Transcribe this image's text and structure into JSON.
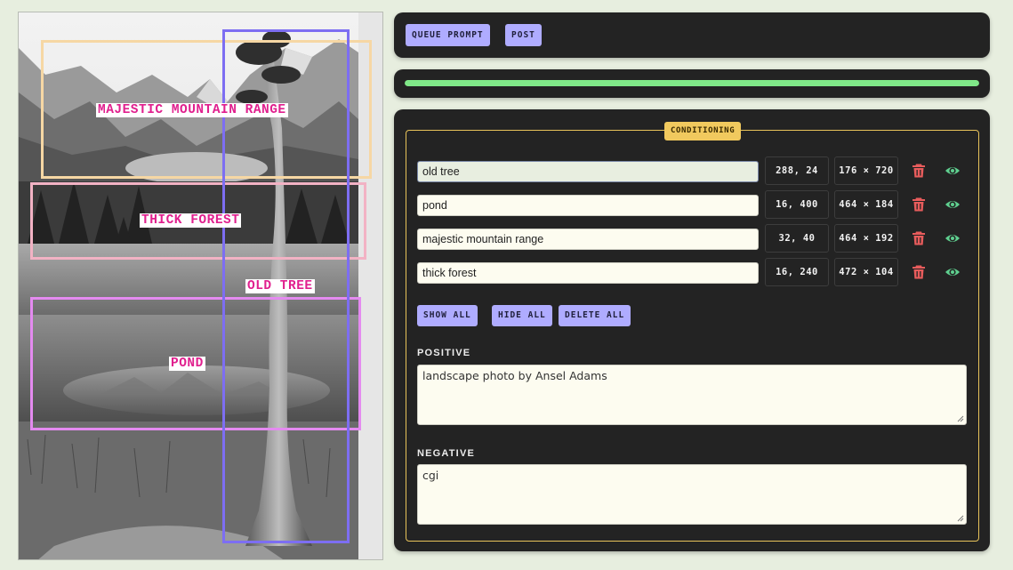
{
  "image": {
    "regions": [
      {
        "key": "mountain",
        "label": "MAJESTIC MOUNTAIN RANGE",
        "color": "#f6d7a4"
      },
      {
        "key": "forest",
        "label": "THICK FOREST",
        "color": "#f2b2c4"
      },
      {
        "key": "tree",
        "label": "OLD TREE",
        "color": "#7d6ef2"
      },
      {
        "key": "pond",
        "label": "POND",
        "color": "#e48af0"
      }
    ]
  },
  "toolbar": {
    "queue_prompt_label": "QUEUE PROMPT",
    "post_label": "POST"
  },
  "progress": {
    "percent": 100,
    "color": "#80e888"
  },
  "conditioning": {
    "legend": "CONDITIONING",
    "rows": [
      {
        "prompt": "old tree",
        "position": "288, 24",
        "size": "176 × 720"
      },
      {
        "prompt": "pond",
        "position": "16, 400",
        "size": "464 × 184"
      },
      {
        "prompt": "majestic mountain range",
        "position": "32, 40",
        "size": "464 × 192"
      },
      {
        "prompt": "thick forest",
        "position": "16, 240",
        "size": "472 × 104"
      }
    ],
    "show_all_label": "SHOW ALL",
    "hide_all_label": "HIDE ALL",
    "delete_all_label": "DELETE ALL",
    "positive_label": "POSITIVE",
    "positive_text": "landscape photo by Ansel Adams",
    "negative_label": "NEGATIVE",
    "negative_text": "cgi"
  },
  "icons": {
    "delete": "trash-icon",
    "visibility": "eye-icon"
  },
  "colors": {
    "accent_button": "#afacff",
    "legend": "#f1c95e",
    "trash": "#e85c5c",
    "eye": "#5fcf8f"
  }
}
